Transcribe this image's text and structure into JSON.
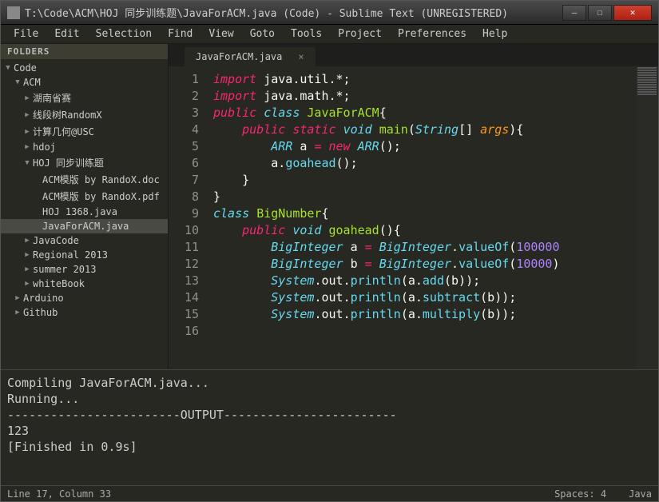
{
  "title": "T:\\Code\\ACM\\HOJ 同步训练题\\JavaForACM.java (Code) - Sublime Text (UNREGISTERED)",
  "menu": [
    "File",
    "Edit",
    "Selection",
    "Find",
    "View",
    "Goto",
    "Tools",
    "Project",
    "Preferences",
    "Help"
  ],
  "sidebarHead": "FOLDERS",
  "tree": [
    {
      "t": "Code",
      "a": "▼",
      "i": 0
    },
    {
      "t": "ACM",
      "a": "▼",
      "i": 1
    },
    {
      "t": "湖南省赛",
      "a": "▶",
      "i": 2
    },
    {
      "t": "线段树RandomX",
      "a": "▶",
      "i": 2
    },
    {
      "t": "计算几何@USC",
      "a": "▶",
      "i": 2
    },
    {
      "t": "hdoj",
      "a": "▶",
      "i": 2
    },
    {
      "t": "HOJ 同步训练题",
      "a": "▼",
      "i": 2
    },
    {
      "t": "ACM模版 by RandoX.doc",
      "a": "",
      "i": 3
    },
    {
      "t": "ACM模版 by RandoX.pdf",
      "a": "",
      "i": 3
    },
    {
      "t": "HOJ 1368.java",
      "a": "",
      "i": 3
    },
    {
      "t": "JavaForACM.java",
      "a": "",
      "i": 3,
      "sel": true
    },
    {
      "t": "JavaCode",
      "a": "▶",
      "i": 2
    },
    {
      "t": "Regional 2013",
      "a": "▶",
      "i": 2
    },
    {
      "t": "summer 2013",
      "a": "▶",
      "i": 2
    },
    {
      "t": "whiteBook",
      "a": "▶",
      "i": 2
    },
    {
      "t": "Arduino",
      "a": "▶",
      "i": 1
    },
    {
      "t": "Github",
      "a": "▶",
      "i": 1
    }
  ],
  "tabLabel": "JavaForACM.java",
  "tabClose": "×",
  "lineNumbers": [
    "1",
    "2",
    "3",
    "4",
    "5",
    "6",
    "7",
    "8",
    "9",
    "10",
    "11",
    "12",
    "13",
    "14",
    "15",
    "16"
  ],
  "code": [
    [
      {
        "c": "kw",
        "t": "import"
      },
      {
        "c": "pl",
        "t": " java"
      },
      {
        "c": "pl",
        "t": "."
      },
      {
        "c": "pl",
        "t": "util"
      },
      {
        "c": "pl",
        "t": ".*;"
      }
    ],
    [
      {
        "c": "kw",
        "t": "import"
      },
      {
        "c": "pl",
        "t": " java"
      },
      {
        "c": "pl",
        "t": "."
      },
      {
        "c": "pl",
        "t": "math"
      },
      {
        "c": "pl",
        "t": ".*;"
      }
    ],
    [
      {
        "c": "kw",
        "t": "public"
      },
      {
        "c": "pl",
        "t": " "
      },
      {
        "c": "kw2",
        "t": "class"
      },
      {
        "c": "pl",
        "t": " "
      },
      {
        "c": "cls",
        "t": "JavaForACM"
      },
      {
        "c": "pl",
        "t": "{"
      }
    ],
    [
      {
        "c": "pl",
        "t": "    "
      },
      {
        "c": "kw",
        "t": "public"
      },
      {
        "c": "pl",
        "t": " "
      },
      {
        "c": "kw",
        "t": "static"
      },
      {
        "c": "pl",
        "t": " "
      },
      {
        "c": "kw2",
        "t": "void"
      },
      {
        "c": "pl",
        "t": " "
      },
      {
        "c": "cls",
        "t": "main"
      },
      {
        "c": "pl",
        "t": "("
      },
      {
        "c": "kw2",
        "t": "String"
      },
      {
        "c": "pl",
        "t": "[] "
      },
      {
        "c": "id",
        "t": "args"
      },
      {
        "c": "pl",
        "t": "){"
      }
    ],
    [
      {
        "c": "pl",
        "t": "        "
      },
      {
        "c": "kw2",
        "t": "ARR"
      },
      {
        "c": "pl",
        "t": " a "
      },
      {
        "c": "op",
        "t": "="
      },
      {
        "c": "pl",
        "t": " "
      },
      {
        "c": "kw",
        "t": "new"
      },
      {
        "c": "pl",
        "t": " "
      },
      {
        "c": "kw2",
        "t": "ARR"
      },
      {
        "c": "pl",
        "t": "();"
      }
    ],
    [
      {
        "c": "pl",
        "t": "        a"
      },
      {
        "c": "pl",
        "t": "."
      },
      {
        "c": "fn",
        "t": "goahead"
      },
      {
        "c": "pl",
        "t": "();"
      }
    ],
    [
      {
        "c": "pl",
        "t": "    }"
      }
    ],
    [
      {
        "c": "pl",
        "t": "}"
      }
    ],
    [
      {
        "c": "pl",
        "t": ""
      }
    ],
    [
      {
        "c": "kw2",
        "t": "class"
      },
      {
        "c": "pl",
        "t": " "
      },
      {
        "c": "cls",
        "t": "BigNumber"
      },
      {
        "c": "pl",
        "t": "{"
      }
    ],
    [
      {
        "c": "pl",
        "t": "    "
      },
      {
        "c": "kw",
        "t": "public"
      },
      {
        "c": "pl",
        "t": " "
      },
      {
        "c": "kw2",
        "t": "void"
      },
      {
        "c": "pl",
        "t": " "
      },
      {
        "c": "cls",
        "t": "goahead"
      },
      {
        "c": "pl",
        "t": "(){"
      }
    ],
    [
      {
        "c": "pl",
        "t": "        "
      },
      {
        "c": "kw2",
        "t": "BigInteger"
      },
      {
        "c": "pl",
        "t": " a "
      },
      {
        "c": "op",
        "t": "="
      },
      {
        "c": "pl",
        "t": " "
      },
      {
        "c": "kw2",
        "t": "BigInteger"
      },
      {
        "c": "pl",
        "t": "."
      },
      {
        "c": "fn",
        "t": "valueOf"
      },
      {
        "c": "pl",
        "t": "("
      },
      {
        "c": "num",
        "t": "100000"
      }
    ],
    [
      {
        "c": "pl",
        "t": "        "
      },
      {
        "c": "kw2",
        "t": "BigInteger"
      },
      {
        "c": "pl",
        "t": " b "
      },
      {
        "c": "op",
        "t": "="
      },
      {
        "c": "pl",
        "t": " "
      },
      {
        "c": "kw2",
        "t": "BigInteger"
      },
      {
        "c": "pl",
        "t": "."
      },
      {
        "c": "fn",
        "t": "valueOf"
      },
      {
        "c": "pl",
        "t": "("
      },
      {
        "c": "num",
        "t": "10000"
      },
      {
        "c": "pl",
        "t": ")"
      }
    ],
    [
      {
        "c": "pl",
        "t": "        "
      },
      {
        "c": "kw2",
        "t": "System"
      },
      {
        "c": "pl",
        "t": "."
      },
      {
        "c": "pl",
        "t": "out"
      },
      {
        "c": "pl",
        "t": "."
      },
      {
        "c": "fn",
        "t": "println"
      },
      {
        "c": "pl",
        "t": "(a"
      },
      {
        "c": "pl",
        "t": "."
      },
      {
        "c": "fn",
        "t": "add"
      },
      {
        "c": "pl",
        "t": "(b));"
      }
    ],
    [
      {
        "c": "pl",
        "t": "        "
      },
      {
        "c": "kw2",
        "t": "System"
      },
      {
        "c": "pl",
        "t": "."
      },
      {
        "c": "pl",
        "t": "out"
      },
      {
        "c": "pl",
        "t": "."
      },
      {
        "c": "fn",
        "t": "println"
      },
      {
        "c": "pl",
        "t": "(a"
      },
      {
        "c": "pl",
        "t": "."
      },
      {
        "c": "fn",
        "t": "subtract"
      },
      {
        "c": "pl",
        "t": "(b));"
      }
    ],
    [
      {
        "c": "pl",
        "t": "        "
      },
      {
        "c": "kw2",
        "t": "System"
      },
      {
        "c": "pl",
        "t": "."
      },
      {
        "c": "pl",
        "t": "out"
      },
      {
        "c": "pl",
        "t": "."
      },
      {
        "c": "fn",
        "t": "println"
      },
      {
        "c": "pl",
        "t": "(a"
      },
      {
        "c": "pl",
        "t": "."
      },
      {
        "c": "fn",
        "t": "multiply"
      },
      {
        "c": "pl",
        "t": "(b));"
      }
    ]
  ],
  "console": "Compiling JavaForACM.java...\nRunning...\n------------------------OUTPUT------------------------\n123\n[Finished in 0.9s]",
  "status": {
    "pos": "Line 17, Column 33",
    "spaces": "Spaces: 4",
    "lang": "Java"
  }
}
